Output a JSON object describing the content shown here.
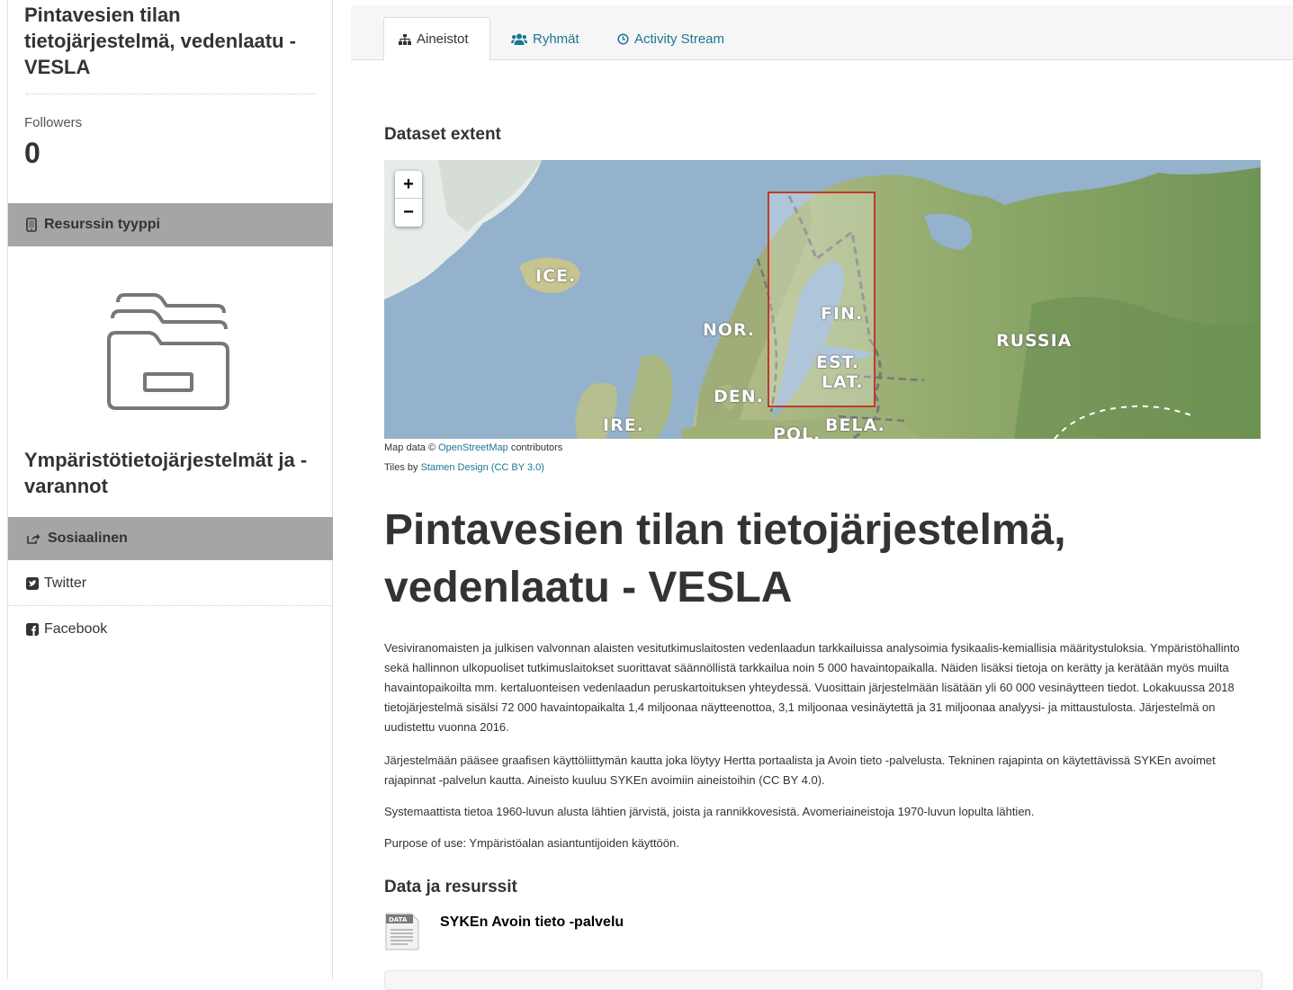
{
  "sidebar": {
    "org_title": "Pintavesien tilan tietojärjestelmä, vedenlaatu - VESLA",
    "followers_label": "Followers",
    "followers_count": "0",
    "resource_type_heading": "Resurssin tyyppi",
    "resource_type_name": "Ympäristötietojärjestelmät ja -varannot",
    "social_heading": "Sosiaalinen",
    "social_links": [
      {
        "label": "Twitter",
        "icon": "twitter-icon"
      },
      {
        "label": "Facebook",
        "icon": "facebook-icon"
      }
    ]
  },
  "tabs": [
    {
      "label": "Aineistot",
      "icon": "sitemap-icon",
      "active": true
    },
    {
      "label": "Ryhmät",
      "icon": "users-icon",
      "active": false
    },
    {
      "label": "Activity Stream",
      "icon": "clock-icon",
      "active": false
    }
  ],
  "map": {
    "heading": "Dataset extent",
    "zoom_in": "+",
    "zoom_out": "−",
    "labels": [
      "ICE.",
      "NOR.",
      "FIN.",
      "EST.",
      "LAT.",
      "DEN.",
      "IRE.",
      "BELA.",
      "POL.",
      "RUSSIA"
    ],
    "attribution_prefix": "Map data ©",
    "attribution_link": "OpenStreetMap",
    "attribution_suffix": "contributors",
    "tiles_prefix": "Tiles by",
    "tiles_link": "Stamen Design (CC BY 3.0)",
    "extent_color": "#c0392b"
  },
  "dataset": {
    "title": "Pintavesien tilan tietojärjestelmä, vedenlaatu - VESLA",
    "paragraphs": [
      "Vesiviranomaisten ja julkisen valvonnan alaisten vesitutkimuslaitosten vedenlaadun tarkkailuissa analysoimia fysikaalis-kemiallisia määritystuloksia. Ympäristöhallinto sekä hallinnon ulkopuoliset tutkimuslaitokset suorittavat säännöllistä tarkkailua noin 5 000 havaintopaikalla. Näiden lisäksi tietoja on kerätty ja kerätään myös muilta havaintopaikoilta mm. kertaluonteisen vedenlaadun peruskartoituksen yhteydessä. Vuosittain järjestelmään lisätään yli 60 000 vesinäytteen tiedot. Lokakuussa 2018 tietojärjestelmä sisälsi 72 000 havaintopaikalta 1,4 miljoonaa näytteenottoa, 3,1 miljoonaa vesinäytettä ja 31 miljoonaa analyysi- ja mittaustulosta. Järjestelmä on uudistettu vuonna 2016.",
      "Järjestelmään pääsee graafisen käyttöliittymän kautta joka löytyy Hertta portaalista ja Avoin tieto -palvelusta. Tekninen rajapinta on käytettävissä SYKEn avoimet rajapinnat -palvelun kautta. Aineisto kuuluu SYKEn avoimiin aineistoihin (CC BY 4.0).",
      "Systemaattista tietoa 1960-luvun alusta lähtien järvistä, joista ja rannikkovesistä. Avomeriaineistoja 1970-luvun lopulta lähtien.",
      "Purpose of use: Ympäristöalan asiantuntijoiden käyttöön."
    ],
    "resources_heading": "Data ja resurssit",
    "resources": [
      {
        "name": "SYKEn Avoin tieto -palvelu",
        "icon": "data-file-icon",
        "icon_label": "DATA"
      }
    ]
  }
}
